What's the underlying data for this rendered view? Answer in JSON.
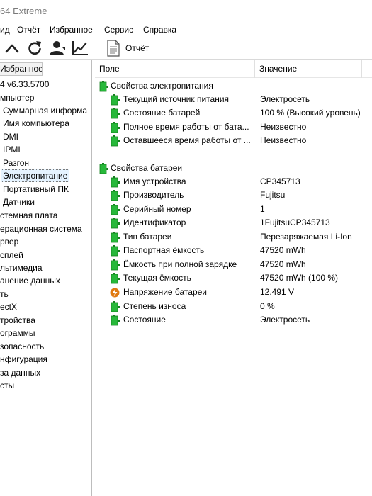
{
  "window": {
    "title": "64 Extreme"
  },
  "menu": [
    "ид",
    "Отчёт",
    "Избранное",
    "Сервис",
    "Справка"
  ],
  "toolbar": {
    "report_label": "Отчёт"
  },
  "left": {
    "fav_tab": "Избранное",
    "tree": [
      "4 v6.33.5700",
      "мпьютер",
      "Суммарная информа",
      "Имя компьютера",
      "DMI",
      "IPMI",
      "Разгон",
      "Электропитание",
      "Портативный ПК",
      "Датчики",
      "стемная плата",
      "ерационная система",
      "рвер",
      "сплей",
      "льтимедиа",
      "анение данных",
      "ть",
      "ectX",
      "тройства",
      "ограммы",
      "зопасность",
      "нфигурация",
      "за данных",
      "сты"
    ]
  },
  "columns": {
    "field": "Поле",
    "value": "Значение"
  },
  "groups": [
    {
      "title": "Свойства электропитания",
      "rows": [
        {
          "field": "Текущий источник питания",
          "value": "Электросеть",
          "icon": "battery-icon"
        },
        {
          "field": "Состояние батарей",
          "value": "100 % (Высокий уровень)",
          "icon": "battery-icon"
        },
        {
          "field": "Полное время работы от бата...",
          "value": "Неизвестно",
          "icon": "battery-icon"
        },
        {
          "field": "Оставшееся время работы от ...",
          "value": "Неизвестно",
          "icon": "battery-icon"
        }
      ]
    },
    {
      "title": "Свойства батареи",
      "rows": [
        {
          "field": "Имя устройства",
          "value": "CP345713",
          "icon": "battery-icon"
        },
        {
          "field": "Производитель",
          "value": "Fujitsu",
          "icon": "battery-icon"
        },
        {
          "field": "Серийный номер",
          "value": "1",
          "icon": "battery-icon"
        },
        {
          "field": "Идентификатор",
          "value": "1FujitsuCP345713",
          "icon": "battery-icon"
        },
        {
          "field": "Тип батареи",
          "value": "Перезаряжаемая Li-Ion",
          "icon": "battery-icon"
        },
        {
          "field": "Паспортная ёмкость",
          "value": "47520 mWh",
          "icon": "battery-icon"
        },
        {
          "field": "Ёмкость при полной зарядке",
          "value": "47520 mWh",
          "icon": "battery-icon"
        },
        {
          "field": "Текущая ёмкость",
          "value": "47520 mWh  (100 %)",
          "icon": "battery-icon"
        },
        {
          "field": "Напряжение батареи",
          "value": "12.491 V",
          "icon": "voltage-icon"
        },
        {
          "field": "Степень износа",
          "value": "0 %",
          "icon": "battery-icon"
        },
        {
          "field": "Состояние",
          "value": "Электросеть",
          "icon": "battery-icon"
        }
      ]
    }
  ],
  "colors": {
    "battery_green": "#27b83a",
    "voltage_orange": "#e07a12",
    "selection": "#e5f3ff"
  }
}
